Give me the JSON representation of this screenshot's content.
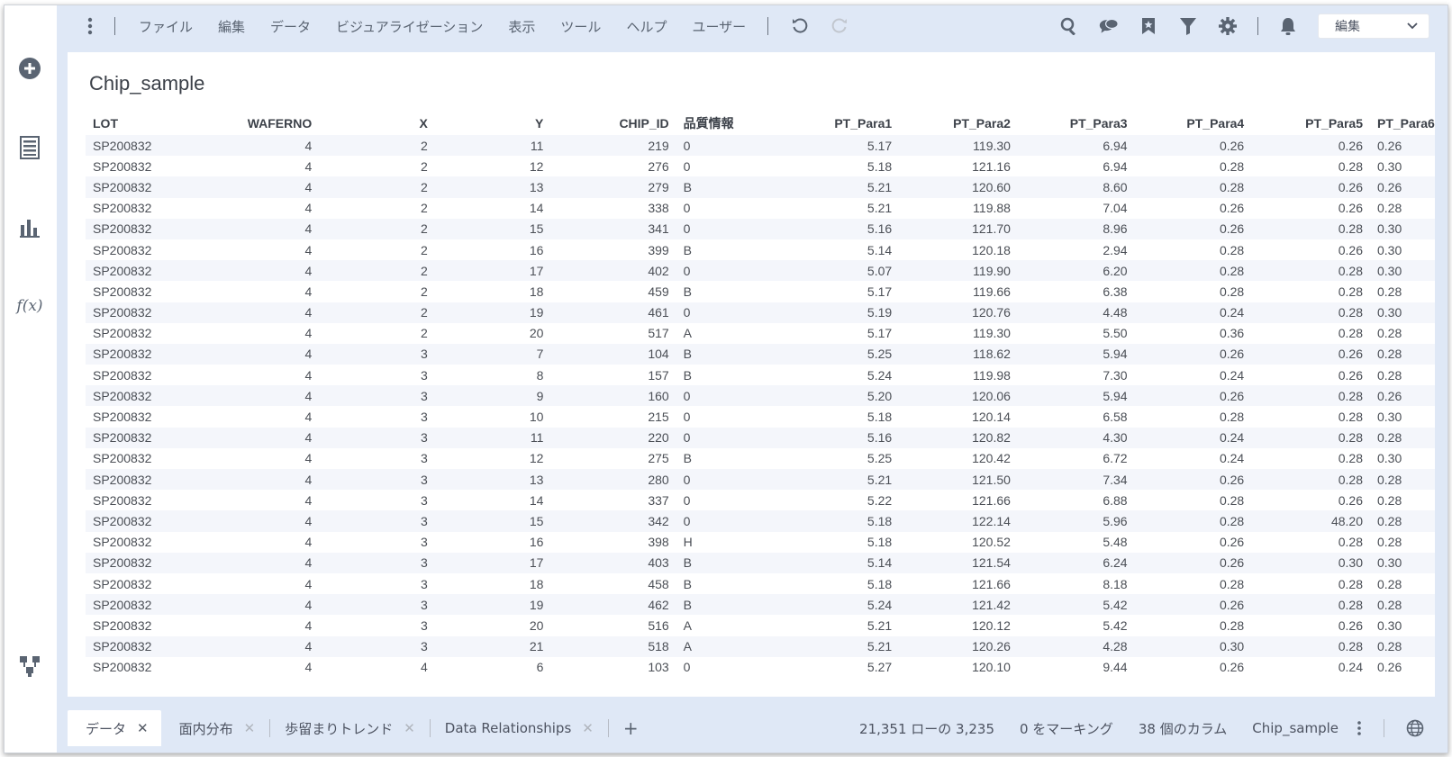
{
  "menu": {
    "items": [
      "ファイル",
      "編集",
      "データ",
      "ビジュアライゼーション",
      "表示",
      "ツール",
      "ヘルプ",
      "ユーザー"
    ],
    "mode_select": "編集"
  },
  "panel": {
    "title": "Chip_sample"
  },
  "table": {
    "columns": [
      "LOT",
      "WAFERNO",
      "X",
      "Y",
      "CHIP_ID",
      "品質情報",
      "PT_Para1",
      "PT_Para2",
      "PT_Para3",
      "PT_Para4",
      "PT_Para5",
      "PT_Para6"
    ],
    "rows": [
      [
        "SP200832",
        "4",
        "2",
        "11",
        "219",
        "0",
        "5.17",
        "119.30",
        "6.94",
        "0.26",
        "0.26",
        "0.26"
      ],
      [
        "SP200832",
        "4",
        "2",
        "12",
        "276",
        "0",
        "5.18",
        "121.16",
        "6.94",
        "0.28",
        "0.28",
        "0.30"
      ],
      [
        "SP200832",
        "4",
        "2",
        "13",
        "279",
        "B",
        "5.21",
        "120.60",
        "8.60",
        "0.28",
        "0.26",
        "0.26"
      ],
      [
        "SP200832",
        "4",
        "2",
        "14",
        "338",
        "0",
        "5.21",
        "119.88",
        "7.04",
        "0.26",
        "0.26",
        "0.28"
      ],
      [
        "SP200832",
        "4",
        "2",
        "15",
        "341",
        "0",
        "5.16",
        "121.70",
        "8.96",
        "0.26",
        "0.28",
        "0.30"
      ],
      [
        "SP200832",
        "4",
        "2",
        "16",
        "399",
        "B",
        "5.14",
        "120.18",
        "2.94",
        "0.28",
        "0.26",
        "0.30"
      ],
      [
        "SP200832",
        "4",
        "2",
        "17",
        "402",
        "0",
        "5.07",
        "119.90",
        "6.20",
        "0.28",
        "0.28",
        "0.30"
      ],
      [
        "SP200832",
        "4",
        "2",
        "18",
        "459",
        "B",
        "5.17",
        "119.66",
        "6.38",
        "0.28",
        "0.28",
        "0.28"
      ],
      [
        "SP200832",
        "4",
        "2",
        "19",
        "461",
        "0",
        "5.19",
        "120.76",
        "4.48",
        "0.24",
        "0.28",
        "0.30"
      ],
      [
        "SP200832",
        "4",
        "2",
        "20",
        "517",
        "A",
        "5.17",
        "119.30",
        "5.50",
        "0.36",
        "0.28",
        "0.28"
      ],
      [
        "SP200832",
        "4",
        "3",
        "7",
        "104",
        "B",
        "5.25",
        "118.62",
        "5.94",
        "0.26",
        "0.26",
        "0.28"
      ],
      [
        "SP200832",
        "4",
        "3",
        "8",
        "157",
        "B",
        "5.24",
        "119.98",
        "7.30",
        "0.24",
        "0.26",
        "0.28"
      ],
      [
        "SP200832",
        "4",
        "3",
        "9",
        "160",
        "0",
        "5.20",
        "120.06",
        "5.94",
        "0.26",
        "0.28",
        "0.26"
      ],
      [
        "SP200832",
        "4",
        "3",
        "10",
        "215",
        "0",
        "5.18",
        "120.14",
        "6.58",
        "0.28",
        "0.28",
        "0.30"
      ],
      [
        "SP200832",
        "4",
        "3",
        "11",
        "220",
        "0",
        "5.16",
        "120.82",
        "4.30",
        "0.24",
        "0.28",
        "0.28"
      ],
      [
        "SP200832",
        "4",
        "3",
        "12",
        "275",
        "B",
        "5.25",
        "120.42",
        "6.72",
        "0.24",
        "0.28",
        "0.30"
      ],
      [
        "SP200832",
        "4",
        "3",
        "13",
        "280",
        "0",
        "5.21",
        "121.50",
        "7.34",
        "0.26",
        "0.28",
        "0.28"
      ],
      [
        "SP200832",
        "4",
        "3",
        "14",
        "337",
        "0",
        "5.22",
        "121.66",
        "6.88",
        "0.28",
        "0.26",
        "0.28"
      ],
      [
        "SP200832",
        "4",
        "3",
        "15",
        "342",
        "0",
        "5.18",
        "122.14",
        "5.96",
        "0.28",
        "48.20",
        "0.28"
      ],
      [
        "SP200832",
        "4",
        "3",
        "16",
        "398",
        "H",
        "5.18",
        "120.52",
        "5.48",
        "0.26",
        "0.28",
        "0.28"
      ],
      [
        "SP200832",
        "4",
        "3",
        "17",
        "403",
        "B",
        "5.14",
        "121.54",
        "6.24",
        "0.26",
        "0.30",
        "0.30"
      ],
      [
        "SP200832",
        "4",
        "3",
        "18",
        "458",
        "B",
        "5.18",
        "121.66",
        "8.18",
        "0.28",
        "0.28",
        "0.28"
      ],
      [
        "SP200832",
        "4",
        "3",
        "19",
        "462",
        "B",
        "5.24",
        "121.42",
        "5.42",
        "0.26",
        "0.28",
        "0.28"
      ],
      [
        "SP200832",
        "4",
        "3",
        "20",
        "516",
        "A",
        "5.21",
        "120.12",
        "5.42",
        "0.28",
        "0.26",
        "0.30"
      ],
      [
        "SP200832",
        "4",
        "3",
        "21",
        "518",
        "A",
        "5.21",
        "120.26",
        "4.28",
        "0.30",
        "0.28",
        "0.28"
      ],
      [
        "SP200832",
        "4",
        "4",
        "6",
        "103",
        "0",
        "5.27",
        "120.10",
        "9.44",
        "0.26",
        "0.24",
        "0.26"
      ]
    ]
  },
  "tabs": [
    {
      "label": "データ",
      "active": true
    },
    {
      "label": "面内分布",
      "active": false
    },
    {
      "label": "歩留まりトレンド",
      "active": false
    },
    {
      "label": "Data Relationships",
      "active": false
    }
  ],
  "status": {
    "rows": "21,351 ローの 3,235",
    "marking": "0 をマーキング",
    "columns": "38 個のカラム",
    "source": "Chip_sample"
  },
  "icons": {
    "rail": [
      "add-icon",
      "data-table-icon",
      "bar-chart-icon",
      "function-icon",
      "data-canvas-icon"
    ],
    "toolbar": [
      "more-vertical-icon",
      "undo-icon",
      "redo-icon",
      "search-icon",
      "comments-icon",
      "bookmark-icon",
      "filter-icon",
      "settings-icon",
      "notification-icon",
      "chevron-down-icon"
    ]
  },
  "colors": {
    "workspace": "#dfe8f6",
    "icon": "#5a6472",
    "accent": "#4a6fa5"
  }
}
